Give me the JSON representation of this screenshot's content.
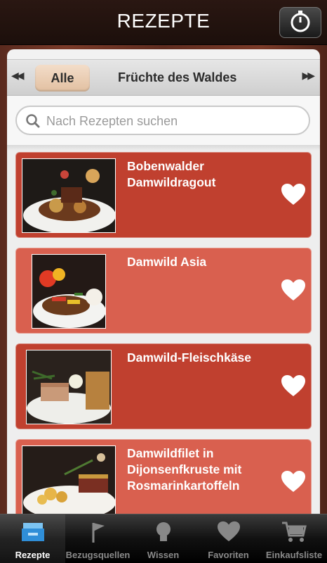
{
  "header": {
    "title": "REZEPTE",
    "timer_icon": "stopwatch-icon"
  },
  "filter": {
    "prev_icon": "double-left-arrow-icon",
    "next_icon": "double-right-arrow-icon",
    "selected": "Alle",
    "category": "Früchte des Waldes"
  },
  "search": {
    "placeholder": "Nach Rezepten suchen",
    "icon": "search-icon"
  },
  "recipes": [
    {
      "title": "Bobenwalder Damwildragout",
      "favorite_icon": "heart-icon"
    },
    {
      "title": "Damwild Asia",
      "favorite_icon": "heart-icon"
    },
    {
      "title": "Damwild-Fleischkäse",
      "favorite_icon": "heart-icon"
    },
    {
      "title": "Damwildfilet in Dijonsenfkruste mit Rosmarinkartoffeln",
      "favorite_icon": "heart-icon"
    }
  ],
  "tabs": [
    {
      "label": "Rezepte",
      "icon": "recipe-box-icon",
      "active": true
    },
    {
      "label": "Bezugsquellen",
      "icon": "flag-icon",
      "active": false
    },
    {
      "label": "Wissen",
      "icon": "lightbulb-icon",
      "active": false
    },
    {
      "label": "Favoriten",
      "icon": "heart-icon",
      "active": false
    },
    {
      "label": "Einkaufsliste",
      "icon": "shopping-cart-icon",
      "active": false
    }
  ],
  "colors": {
    "card_dark": "#c0402f",
    "card_light": "#d9604f",
    "chip": "#e2c0a1",
    "tab_active_icon": "#3aa0e8"
  }
}
